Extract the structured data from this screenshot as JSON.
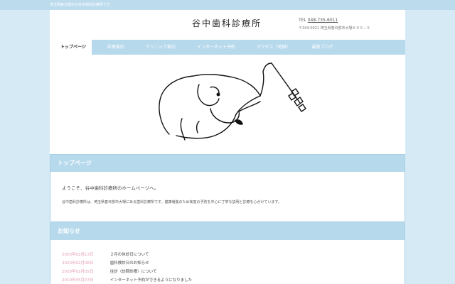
{
  "site": {
    "tagline": "埼玉県春日部市の谷中歯科診療所です",
    "title": "谷中歯科診療所",
    "tel_label": "TEL",
    "tel_number": "048-735-6011",
    "address": "〒344-0021 埼玉県春日部市大場６９０－５"
  },
  "nav": {
    "items": [
      {
        "label": "トップページ"
      },
      {
        "label": "診療案内"
      },
      {
        "label": "クリニック案内"
      },
      {
        "label": "インターネット予約"
      },
      {
        "label": "アクセス（地図）"
      },
      {
        "label": "最新ブログ"
      }
    ]
  },
  "intro": {
    "heading": "トップページ",
    "welcome": "ようこそ、谷中歯科診療所のホームページへ。",
    "description": "谷中歯科診療所は、埼玉県春日部市大場にある歯科診療所です。健康増進のため疾患の予防を中心に丁寧な説明と診療を心がけています。"
  },
  "news": {
    "heading": "お知らせ",
    "items": [
      {
        "date": "2020年02月13日",
        "title": "２月の休診日について"
      },
      {
        "date": "2020年02月06日",
        "title": "歯科検診日のお知らせ"
      },
      {
        "date": "2020年02月05日",
        "title": "往診（訪問診療）について"
      },
      {
        "date": "2019年05月07日",
        "title": "インターネット予約ができるようになりました"
      }
    ]
  },
  "colors": {
    "background": "#d6eaf5",
    "accent": "#b7d9ec",
    "date": "#e39bb2"
  },
  "icons": {
    "hero": "elephant-toothbrush-illustration"
  }
}
